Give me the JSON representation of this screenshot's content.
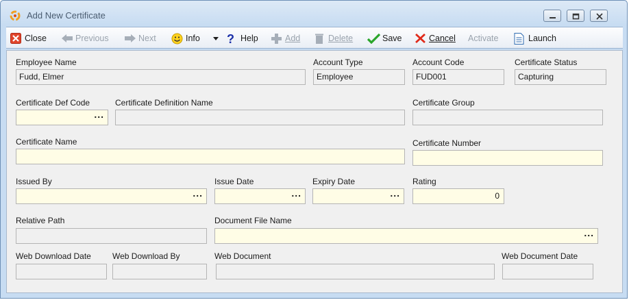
{
  "window": {
    "title": "Add New Certificate"
  },
  "toolbar": {
    "close": "Close",
    "previous": "Previous",
    "next": "Next",
    "info": "Info",
    "help": "Help",
    "add": "Add",
    "delete": "Delete",
    "save": "Save",
    "cancel": "Cancel",
    "activate": "Activate",
    "launch": "Launch"
  },
  "form": {
    "employee_name": {
      "label": "Employee Name",
      "value": "Fudd, Elmer"
    },
    "account_type": {
      "label": "Account Type",
      "value": "Employee"
    },
    "account_code": {
      "label": "Account Code",
      "value": "FUD001"
    },
    "certificate_status": {
      "label": "Certificate Status",
      "value": "Capturing"
    },
    "certificate_def_code": {
      "label": "Certificate Def Code",
      "value": ""
    },
    "certificate_definition_name": {
      "label": "Certificate Definition Name",
      "value": ""
    },
    "certificate_group": {
      "label": "Certificate Group",
      "value": ""
    },
    "certificate_name": {
      "label": "Certificate Name",
      "value": ""
    },
    "certificate_number": {
      "label": "Certificate Number",
      "value": ""
    },
    "issued_by": {
      "label": "Issued By",
      "value": ""
    },
    "issue_date": {
      "label": "Issue Date",
      "value": ""
    },
    "expiry_date": {
      "label": "Expiry Date",
      "value": ""
    },
    "rating": {
      "label": "Rating",
      "value": "0"
    },
    "relative_path": {
      "label": "Relative Path",
      "value": ""
    },
    "document_file_name": {
      "label": "Document File Name",
      "value": ""
    },
    "web_download_date": {
      "label": "Web Download Date",
      "value": ""
    },
    "web_download_by": {
      "label": "Web Download By",
      "value": ""
    },
    "web_document": {
      "label": "Web Document",
      "value": ""
    },
    "web_document_date": {
      "label": "Web Document Date",
      "value": ""
    },
    "ellipsis": "..."
  },
  "colors": {
    "editable_field": "#fffde6",
    "readonly_field": "#f0f0f0",
    "title_bar": "#c7dcf2"
  }
}
